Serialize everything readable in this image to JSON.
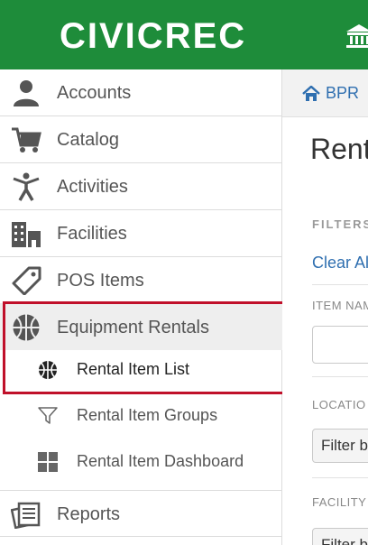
{
  "header": {
    "logo_text": "CIVICREC",
    "brand_color": "#1e8c3a",
    "right_icon": "institution-icon"
  },
  "sidebar": {
    "items": [
      {
        "label": "Accounts",
        "icon": "person-icon"
      },
      {
        "label": "Catalog",
        "icon": "cart-icon"
      },
      {
        "label": "Activities",
        "icon": "activity-figure-icon"
      },
      {
        "label": "Facilities",
        "icon": "buildings-icon"
      },
      {
        "label": "POS Items",
        "icon": "tag-icon"
      },
      {
        "label": "Equipment Rentals",
        "icon": "basketball-icon"
      },
      {
        "label": "Reports",
        "icon": "reports-icon"
      }
    ],
    "equipment_sub_items": [
      {
        "label": "Rental Item List",
        "icon": "basketball-icon",
        "active": true
      },
      {
        "label": "Rental Item Groups",
        "icon": "filter-icon",
        "active": false
      },
      {
        "label": "Rental Item Dashboard",
        "icon": "dashboard-grid-icon",
        "active": false
      }
    ],
    "highlight_color": "#c0102a"
  },
  "main": {
    "breadcrumb": "BPR",
    "page_title": "Rent",
    "filters_label": "FILTERS",
    "clear_link": "Clear Al",
    "item_name_label": "ITEM NAM",
    "location_label": "LOCATIO",
    "location_select": "Filter b",
    "facility_label": "FACILITY",
    "facility_select": "Filter b"
  }
}
